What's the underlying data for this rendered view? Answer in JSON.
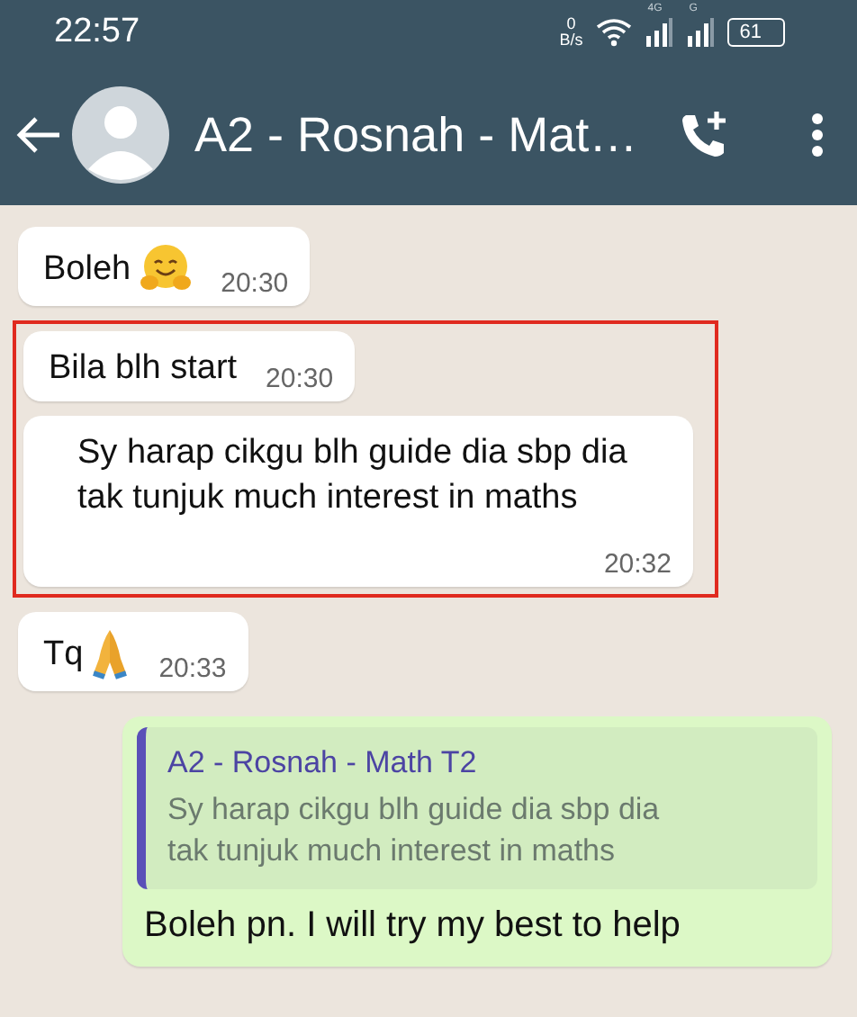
{
  "status_bar": {
    "time": "22:57",
    "speed_value": "0",
    "speed_unit": "B/s",
    "network_1": "4G",
    "network_2": "G",
    "battery": "61"
  },
  "header": {
    "title": "A2 - Rosnah - Mat…"
  },
  "messages": [
    {
      "kind": "incoming",
      "text": "Boleh",
      "emoji": {
        "kind": "hug"
      },
      "time": "20:30"
    },
    {
      "kind": "highlight_frame",
      "messages": [
        {
          "kind": "incoming",
          "text": "Bila blh start",
          "time": "20:30"
        },
        {
          "kind": "incoming",
          "text": "Sy harap cikgu blh guide dia sbp dia tak tunjuk much interest in maths",
          "time": "20:32"
        }
      ]
    },
    {
      "kind": "incoming",
      "text": "Tq",
      "emoji": {
        "kind": "pray"
      },
      "time": "20:33"
    },
    {
      "kind": "outgoing",
      "reply": {
        "author": "A2 - Rosnah - Math T2",
        "text": "Sy harap cikgu blh guide dia sbp dia tak tunjuk much interest in maths"
      },
      "text": "Boleh pn. I will try my best to help"
    }
  ]
}
